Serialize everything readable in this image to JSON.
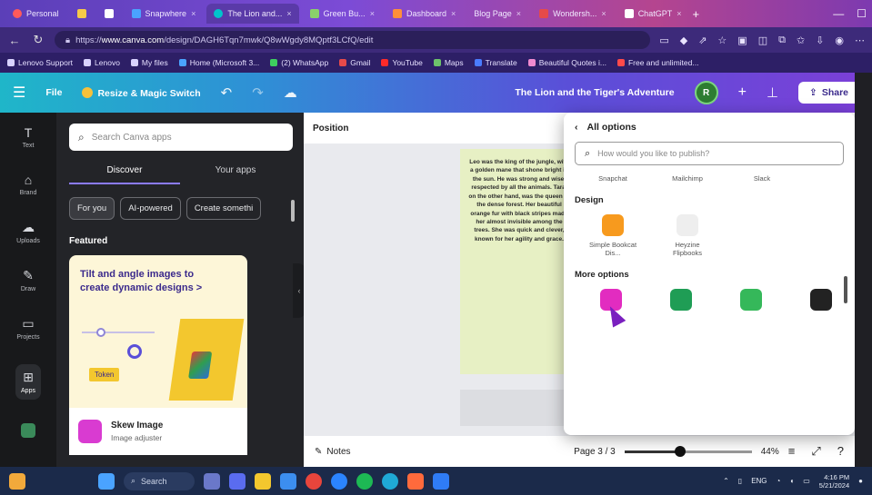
{
  "browser": {
    "tabs": [
      {
        "label": "Personal"
      },
      {
        "label": ""
      },
      {
        "label": ""
      },
      {
        "label": "Snapwhere"
      },
      {
        "label": "The Lion and..."
      },
      {
        "label": "Green Bu..."
      },
      {
        "label": "Dashboard"
      },
      {
        "label": "Blog Page"
      },
      {
        "label": "Wondersh..."
      },
      {
        "label": "ChatGPT"
      }
    ],
    "url_prefix": "https://",
    "url_domain": "www.canva.com",
    "url_rest": "/design/DAGH6Tqn7mwk/Q8wWgdy8MQptf3LCfQ/edit",
    "bookmarks": [
      "Lenovo Support",
      "Lenovo",
      "My files",
      "Home (Microsoft 3...",
      "(2) WhatsApp",
      "Gmail",
      "YouTube",
      "Maps",
      "Translate",
      "Beautiful Quotes i...",
      "Free and unlimited..."
    ]
  },
  "canva_header": {
    "file_label": "File",
    "resize_label": "Resize & Magic Switch",
    "doc_title": "The Lion and the Tiger's Adventure",
    "avatar_initial": "R",
    "share_label": "Share"
  },
  "rail": [
    {
      "label": "Text",
      "icon": "text-icon"
    },
    {
      "label": "Brand",
      "icon": "brand-icon"
    },
    {
      "label": "Uploads",
      "icon": "upload-icon"
    },
    {
      "label": "Draw",
      "icon": "draw-icon"
    },
    {
      "label": "Projects",
      "icon": "folder-icon"
    },
    {
      "label": "Apps",
      "icon": "apps-icon"
    },
    {
      "label": "",
      "icon": "app-icon"
    }
  ],
  "panel": {
    "search_placeholder": "Search Canva apps",
    "tabs": [
      "Discover",
      "Your apps"
    ],
    "chips": [
      "For you",
      "AI-powered",
      "Create somethi"
    ],
    "featured_label": "Featured",
    "card_title": "Tilt and angle images to create dynamic designs >",
    "card_tag": "Token",
    "app_name": "Skew Image",
    "app_sub": "Image adjuster"
  },
  "canvas": {
    "top_label": "Position",
    "page_text": "Leo was the king of the jungle, with a golden mane that shone bright in the sun. He was strong and wise, respected by all the animals. Tara, on the other hand, was the queen of the dense forest. Her beautiful orange fur with black stripes made her almost invisible among the trees. She was quick and clever, known for her agility and grace.",
    "notes_label": "Notes",
    "page_indicator": "Page 3 / 3",
    "zoom": "44%",
    "zoom_fraction": 0.44
  },
  "share_menu": {
    "back_label": "All options",
    "search_placeholder": "How would you like to publish?",
    "top_row": [
      "Snapchat",
      "Mailchimp",
      "Slack"
    ],
    "design_section": "Design",
    "design_items": [
      "Simple Bookcat Dis...",
      "Heyzine Flipbooks"
    ],
    "more_section": "More options",
    "more_items": [
      "",
      "",
      "",
      ""
    ]
  },
  "taskbar": {
    "search_label": "Search",
    "time": "4:16 PM",
    "date": "5/21/2024",
    "lang": "ENG"
  },
  "colors": {
    "header_gradient_start": "#1fb6c9",
    "header_gradient_end": "#7c3fd8",
    "panel_bg": "#232428",
    "card_bg": "#fdf6d8",
    "page_bg": "#e7f0c4",
    "accent_purple": "#3b2a8c"
  }
}
